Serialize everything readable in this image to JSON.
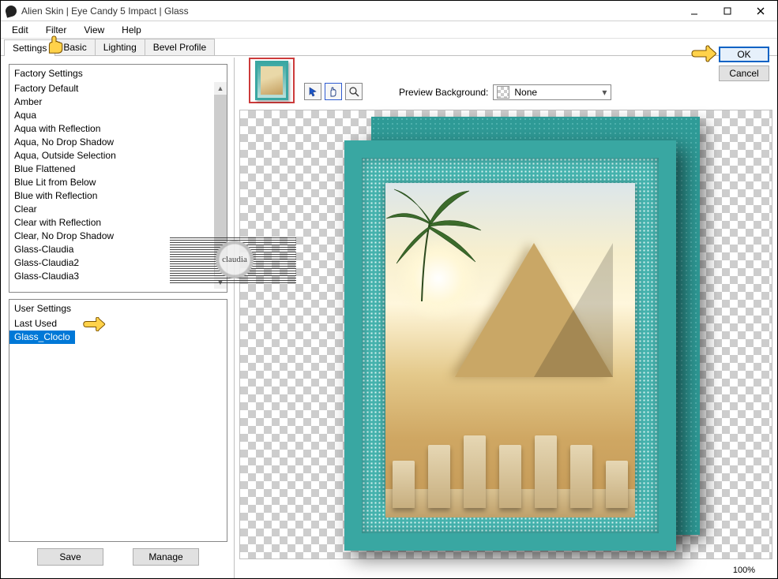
{
  "window": {
    "title": "Alien Skin | Eye Candy 5 Impact | Glass"
  },
  "menu": {
    "edit": "Edit",
    "filter": "Filter",
    "view": "View",
    "help": "Help"
  },
  "tabs": {
    "settings": "Settings",
    "basic": "Basic",
    "lighting": "Lighting",
    "bevel": "Bevel Profile"
  },
  "factory": {
    "header": "Factory Settings",
    "items": [
      "Factory Default",
      "Amber",
      "Aqua",
      "Aqua with Reflection",
      "Aqua, No Drop Shadow",
      "Aqua, Outside Selection",
      "Blue Flattened",
      "Blue Lit from Below",
      "Blue with Reflection",
      "Clear",
      "Clear with Reflection",
      "Clear, No Drop Shadow",
      "Glass-Claudia",
      "Glass-Claudia2",
      "Glass-Claudia3"
    ]
  },
  "user": {
    "header": "User Settings",
    "items": [
      "Last Used",
      "Glass_Cloclo"
    ],
    "selected_index": 1
  },
  "buttons": {
    "save": "Save",
    "manage": "Manage",
    "ok": "OK",
    "cancel": "Cancel"
  },
  "preview": {
    "bg_label": "Preview Background:",
    "bg_value": "None",
    "zoom": "100%"
  },
  "watermark": "claudia"
}
